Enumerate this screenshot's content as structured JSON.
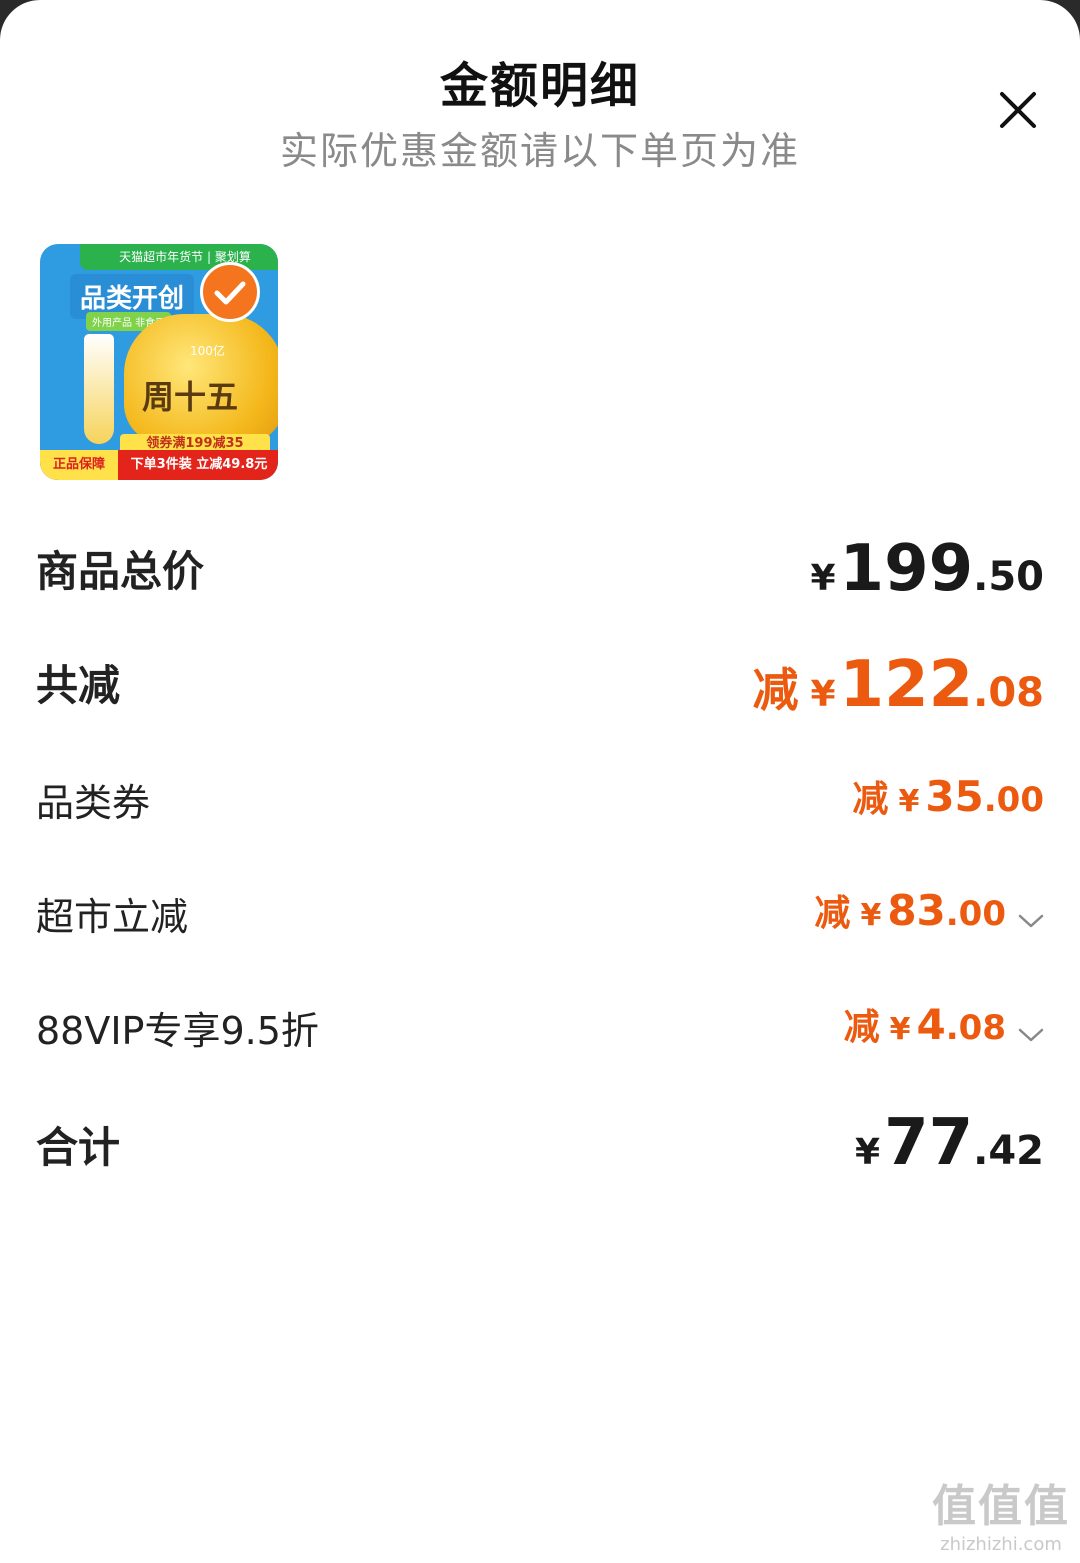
{
  "header": {
    "title": "金额明细",
    "subtitle": "实际优惠金额请以下单页为准",
    "close_icon": "close-icon"
  },
  "product_image": {
    "top_bar": "天猫超市年货节 | 聚划算",
    "category_text": "品类开创",
    "tag": "外用产品 非食用",
    "blob_number": "100亿",
    "blob_text": "周十五",
    "coupon": "领券满199减35",
    "bottom_left": "正品保障",
    "bottom_right": "下单3件装 立减49.8元",
    "selected_icon": "check-icon"
  },
  "rows": {
    "total_price": {
      "label": "商品总价",
      "currency": "¥",
      "int": "199",
      "dec": ".50"
    },
    "total_reduction": {
      "label": "共减",
      "prefix": "减",
      "currency": "¥",
      "int": "122",
      "dec": ".08"
    },
    "category_coupon": {
      "label": "品类券",
      "prefix": "减",
      "currency": "¥",
      "int": "35",
      "dec": ".00"
    },
    "supermarket_discount": {
      "label": "超市立减",
      "prefix": "减",
      "currency": "¥",
      "int": "83",
      "dec": ".00",
      "icon": "chevron-down-icon"
    },
    "vip_discount": {
      "label": "88VIP专享9.5折",
      "prefix": "减",
      "currency": "¥",
      "int": "4",
      "dec": ".08",
      "icon": "chevron-down-icon"
    },
    "grand_total": {
      "label": "合计",
      "currency": "¥",
      "int": "77",
      "dec": ".42"
    }
  },
  "watermark": {
    "main": "值值值",
    "sub": "zhizhizhi.com"
  },
  "colors": {
    "accent_orange": "#ec5a10",
    "text_dark": "#1a1a1a",
    "subtitle_gray": "#8a8a8a"
  }
}
